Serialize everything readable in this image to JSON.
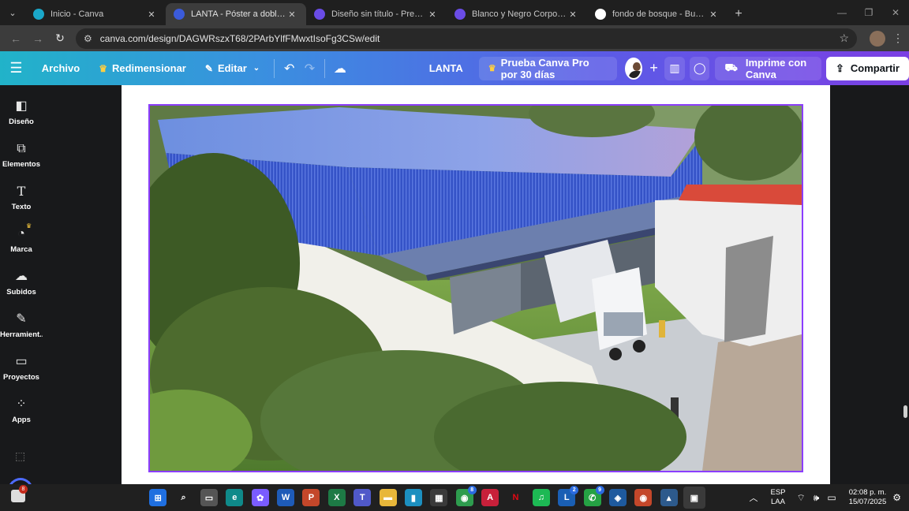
{
  "browser": {
    "tabs": [
      {
        "label": "Inicio - Canva",
        "favicon_color": "#1aa7c9",
        "active": false
      },
      {
        "label": "LANTA - Póster a doble cara (A",
        "favicon_color": "#3b5bdb",
        "active": true
      },
      {
        "label": "Diseño sin título - Presentación",
        "favicon_color": "#6a4ce6",
        "active": false
      },
      {
        "label": "Blanco y Negro Corporativo Ar",
        "favicon_color": "#6a4ce6",
        "active": false
      },
      {
        "label": "fondo de bosque - Buscar con G",
        "favicon_color": "#ffffff",
        "active": false
      }
    ],
    "close_glyph": "✕",
    "new_tab_glyph": "+",
    "url": "canva.com/design/DAGWRszxT68/2PArbYlfFMwxtIsoFg3CSw/edit"
  },
  "toolbar": {
    "file_label": "Archivo",
    "resize_label": "Redimensionar",
    "edit_label": "Editar",
    "doc_title": "LANTA",
    "pro_trial_label": "Prueba Canva Pro por 30 días",
    "print_label": "Imprime con Canva",
    "share_label": "Compartir"
  },
  "sidebar": {
    "items": [
      {
        "label": "Diseño",
        "icon": "layout-icon"
      },
      {
        "label": "Elementos",
        "icon": "shapes-icon"
      },
      {
        "label": "Texto",
        "icon": "text-icon"
      },
      {
        "label": "Marca",
        "icon": "brand-icon"
      },
      {
        "label": "Subidos",
        "icon": "upload-cloud-icon"
      },
      {
        "label": "Herramient...",
        "icon": "tools-icon"
      },
      {
        "label": "Proyectos",
        "icon": "folder-icon"
      },
      {
        "label": "Apps",
        "icon": "apps-grid-icon"
      }
    ]
  },
  "canvas": {
    "image_subject": "warehouse-rendering",
    "selection_color": "#8b3dff"
  },
  "taskbar": {
    "notification_count": "8",
    "apps": [
      {
        "name": "windows-start-icon",
        "glyph": "⊞",
        "bg": "#1f6fe0"
      },
      {
        "name": "search-icon",
        "glyph": "⌕",
        "bg": "transparent"
      },
      {
        "name": "task-view-icon",
        "glyph": "▭",
        "bg": "#555555"
      },
      {
        "name": "edge-icon",
        "glyph": "e",
        "bg": "#0f8a8a"
      },
      {
        "name": "copilot-icon",
        "glyph": "✿",
        "bg": "#7a5cff"
      },
      {
        "name": "word-icon",
        "glyph": "W",
        "bg": "#1e5bb8"
      },
      {
        "name": "powerpoint-icon",
        "glyph": "P",
        "bg": "#c4472a"
      },
      {
        "name": "excel-icon",
        "glyph": "X",
        "bg": "#1d7a45"
      },
      {
        "name": "teams-icon",
        "glyph": "T",
        "bg": "#5059c9"
      },
      {
        "name": "file-explorer-icon",
        "glyph": "▬",
        "bg": "#e8b73a"
      },
      {
        "name": "books-icon",
        "glyph": "▮",
        "bg": "#1c8fbf"
      },
      {
        "name": "store-icon",
        "glyph": "▦",
        "bg": "#3a3a3a"
      },
      {
        "name": "chrome-icon",
        "glyph": "◉",
        "bg": "#2e9c4e",
        "badge": "8"
      },
      {
        "name": "autocad-icon",
        "glyph": "A",
        "bg": "#c8203a"
      },
      {
        "name": "netflix-icon",
        "glyph": "N",
        "bg": "#202020",
        "color": "#e50914"
      },
      {
        "name": "spotify-icon",
        "glyph": "♫",
        "bg": "#1db954"
      },
      {
        "name": "linkedin-icon",
        "glyph": "L",
        "bg": "#1a5fb4",
        "badge": "2"
      },
      {
        "name": "whatsapp-icon",
        "glyph": "✆",
        "bg": "#25a244",
        "badge": "9"
      },
      {
        "name": "app-blue-cube-icon",
        "glyph": "◈",
        "bg": "#1e5a9e"
      },
      {
        "name": "chrome-profile-icon",
        "glyph": "◉",
        "bg": "#c4472a"
      },
      {
        "name": "sketchup-icon",
        "glyph": "▴",
        "bg": "#2d5a8c"
      },
      {
        "name": "canva-app-icon",
        "glyph": "▣",
        "bg": "#3a3a3a",
        "active": true
      }
    ],
    "language": "ESP",
    "keyboard": "LAA",
    "time": "02:08 p. m.",
    "date": "15/07/2025"
  }
}
